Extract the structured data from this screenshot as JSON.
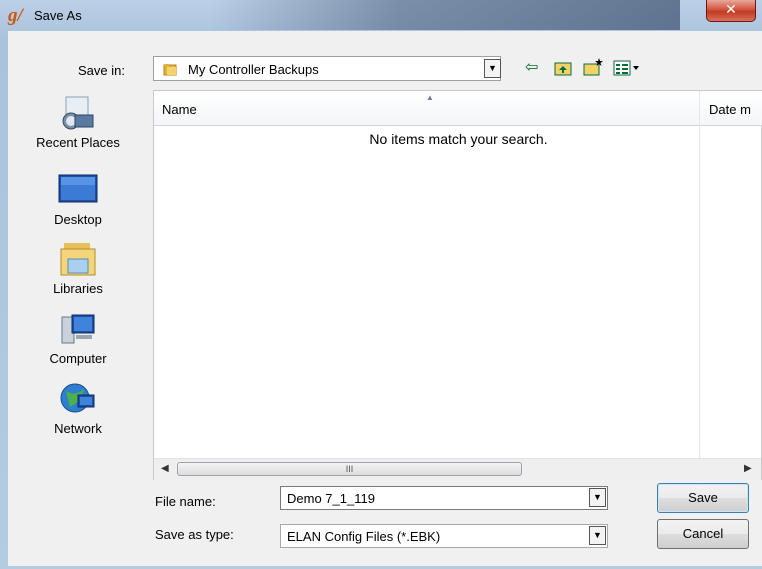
{
  "window": {
    "title": "Save As",
    "app_icon": "g/",
    "close_glyph": "✕"
  },
  "toolbar": {
    "save_in_label": "Save in:",
    "save_in_value": "My Controller Backups",
    "icons": [
      "back-arrow-icon",
      "up-folder-icon",
      "new-folder-icon",
      "view-menu-icon"
    ]
  },
  "places": [
    {
      "label": "Recent Places",
      "icon": "recent-places-icon"
    },
    {
      "label": "Desktop",
      "icon": "desktop-icon"
    },
    {
      "label": "Libraries",
      "icon": "libraries-icon"
    },
    {
      "label": "Computer",
      "icon": "computer-icon"
    },
    {
      "label": "Network",
      "icon": "network-icon"
    }
  ],
  "list": {
    "columns": [
      "Name",
      "Date m"
    ],
    "empty_message": "No items match your search.",
    "scroll_thumb_label": "III"
  },
  "form": {
    "file_name_label": "File name:",
    "file_name_value": "Demo 7_1_119",
    "save_type_label": "Save as type:",
    "save_type_value": "ELAN Config Files (*.EBK)"
  },
  "buttons": {
    "save": "Save",
    "cancel": "Cancel"
  },
  "colors": {
    "title_glass": "#aac2dc",
    "close": "#c23a23",
    "client": "#f0f0f0"
  }
}
